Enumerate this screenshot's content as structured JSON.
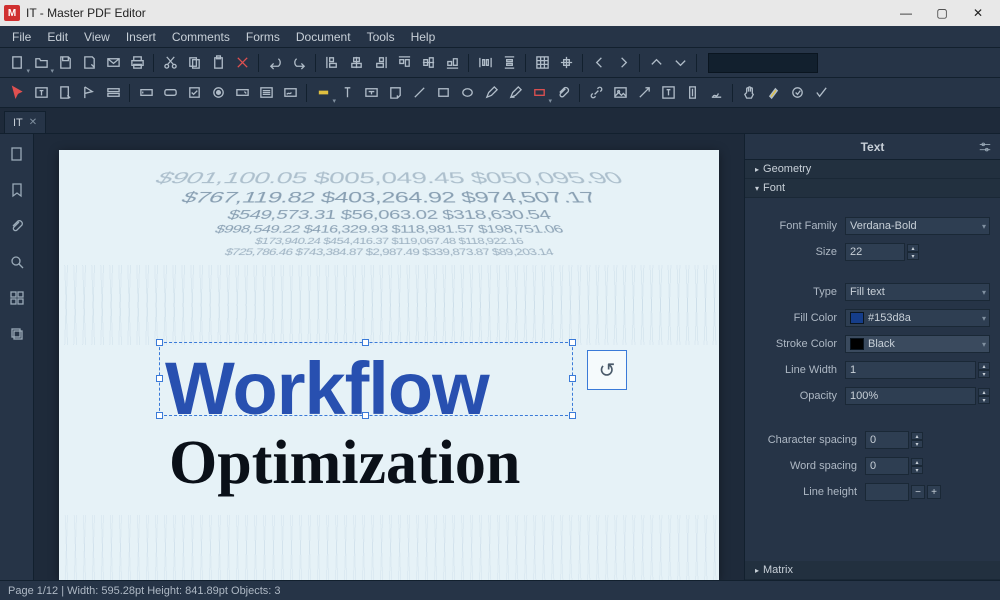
{
  "app": {
    "title": "IT - Master PDF Editor",
    "logo_letter": "M"
  },
  "menu": [
    "File",
    "Edit",
    "View",
    "Insert",
    "Comments",
    "Forms",
    "Document",
    "Tools",
    "Help"
  ],
  "tab": {
    "label": "IT"
  },
  "document": {
    "headline1": "Workflow",
    "headline2": "Optimization",
    "bg_numbers": [
      "$901,100.05   $005,049.45  $050,095.90",
      "$767,119.82   $403,264.92   $974,507.17",
      "$549,573.31    $56,063.02   $318,630.54",
      "$998,549.22   $416,329.93   $118,981.57  $198,751.06",
      "$173,940.24  $454,416.37  $119,067.48  $118,922.16",
      "$725,786.46  $743,384.87  $2,987.49  $339,873.87  $89,203.14"
    ]
  },
  "panel": {
    "title": "Text",
    "sections": {
      "geometry": "Geometry",
      "font": "Font",
      "matrix": "Matrix"
    },
    "font": {
      "family_label": "Font Family",
      "family_value": "Verdana-Bold",
      "size_label": "Size",
      "size_value": "22",
      "type_label": "Type",
      "type_value": "Fill text",
      "fill_label": "Fill Color",
      "fill_value": "#153d8a",
      "stroke_label": "Stroke Color",
      "stroke_value": "Black",
      "linewidth_label": "Line Width",
      "linewidth_value": "1",
      "opacity_label": "Opacity",
      "opacity_value": "100%",
      "charspace_label": "Character spacing",
      "charspace_value": "0",
      "wordspace_label": "Word spacing",
      "wordspace_value": "0",
      "lineheight_label": "Line height",
      "lineheight_value": ""
    }
  },
  "status": "Page 1/12 | Width: 595.28pt Height: 841.89pt Objects: 3",
  "colors": {
    "fill": "#153d8a",
    "stroke": "#000000"
  }
}
